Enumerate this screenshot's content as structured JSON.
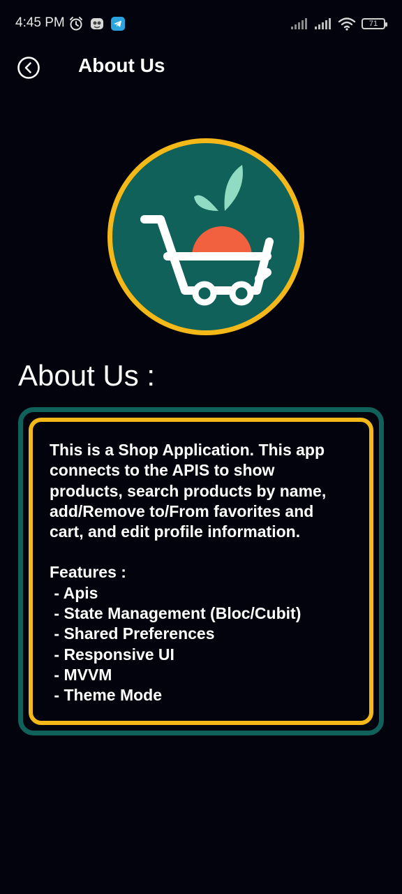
{
  "status_bar": {
    "time": "4:45 PM",
    "left_icons": [
      "alarm-icon",
      "app-notification-icon",
      "telegram-icon"
    ],
    "right_icons": [
      "signal-icon",
      "signal-icon",
      "wifi-icon"
    ],
    "battery": "71"
  },
  "app_bar": {
    "back_icon": "back-arrow-icon",
    "title": "About Us"
  },
  "logo": {
    "icon": "shopping-cart-carrot-logo",
    "colors": {
      "ring": "#f5b819",
      "fill": "#0f6159",
      "leaf": "#8fdcc2",
      "carrot": "#f2613f",
      "cart": "#ffffff"
    }
  },
  "section": {
    "heading": "About Us :"
  },
  "card": {
    "description": "This is a Shop Application. This app\nconnects to the APIS to show\nproducts, search products by name,\nadd/Remove to/From favorites and\ncart, and edit profile information.",
    "features_title": "Features :",
    "features": [
      " - Apis",
      " - State Management (Bloc/Cubit)",
      " - Shared Preferences",
      " - Responsive UI",
      " - MVVM",
      " - Theme Mode"
    ],
    "colors": {
      "outer_border": "#0f6159",
      "inner_border": "#f5b819",
      "background": "#03030d"
    }
  }
}
